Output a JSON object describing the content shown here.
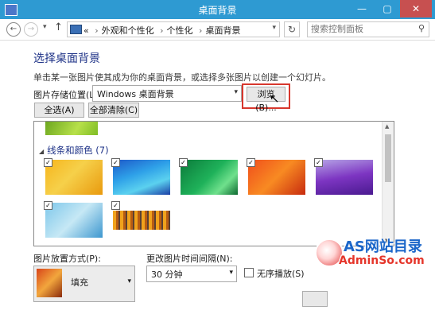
{
  "window": {
    "title": "桌面背景",
    "min": "—",
    "max": "▢",
    "close": "✕"
  },
  "nav": {
    "back": "←",
    "forward": "→",
    "up": "↑",
    "dropdown": "▾",
    "address_prefix": "«",
    "breadcrumbs": [
      "外观和个性化",
      "个性化",
      "桌面背景"
    ],
    "breadcrumb_sep": "›",
    "address_dropdown": "▾",
    "refresh": "↻",
    "search_placeholder": "搜索控制面板",
    "search_icon": "⚲"
  },
  "main": {
    "heading": "选择桌面背景",
    "subtext": "单击某一张图片使其成为你的桌面背景，或选择多张图片以创建一个幻灯片。",
    "location_label": "图片存储位置(L):",
    "location_value": "Windows 桌面背景",
    "select_arrow": "▾",
    "browse_label": "浏览(B)...",
    "select_all_label": "全选(A)",
    "clear_all_label": "全部清除(C)",
    "cursor": "↖"
  },
  "gallery": {
    "group_toggle": "◢",
    "group_label": "线条和颜色 (7)",
    "check": "✓",
    "scroll_up": "▲",
    "scroll_down": "▼"
  },
  "bottom": {
    "position_label": "图片放置方式(P):",
    "position_value": "填充",
    "interval_label": "更改图片时间间隔(N):",
    "interval_value": "30 分钟",
    "shuffle_label": "无序播放(S)"
  },
  "watermark": {
    "line1": "AS网站目录",
    "line2": "AdminSo.com"
  }
}
